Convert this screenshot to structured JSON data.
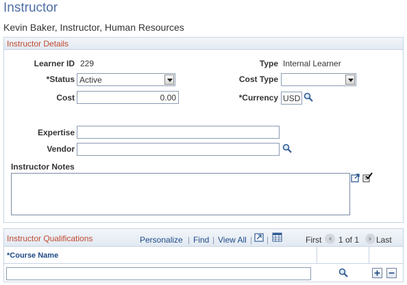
{
  "page": {
    "title": "Instructor",
    "subtitle": "Kevin Baker, Instructor, Human Resources"
  },
  "details": {
    "header": "Instructor Details",
    "learner_id_label": "Learner ID",
    "learner_id_value": "229",
    "type_label": "Type",
    "type_value": "Internal Learner",
    "status_label": "*Status",
    "status_value": "Active",
    "cost_type_label": "Cost Type",
    "cost_type_value": "",
    "cost_label": "Cost",
    "cost_value": "0.00",
    "currency_label": "*Currency",
    "currency_value": "USD",
    "expertise_label": "Expertise",
    "expertise_value": "",
    "vendor_label": "Vendor",
    "vendor_value": "",
    "notes_label": "Instructor Notes",
    "notes_value": ""
  },
  "qualifications": {
    "header": "Instructor Qualifications",
    "personalize": "Personalize",
    "find": "Find",
    "view_all": "View All",
    "first": "First",
    "range": "1 of 1",
    "last": "Last",
    "column_course_name": "*Course Name",
    "rows": [
      {
        "course_name": ""
      }
    ]
  },
  "colors": {
    "title_blue": "#4f6ea6",
    "header_red": "#c0492f",
    "link_blue": "#1f4a86",
    "border": "#c7d3e3"
  },
  "icons": [
    "search-icon",
    "expand-icon",
    "spellcheck-icon",
    "grid-zoom-icon",
    "download-icon",
    "prev-icon",
    "next-icon",
    "add-row-icon",
    "delete-row-icon"
  ]
}
